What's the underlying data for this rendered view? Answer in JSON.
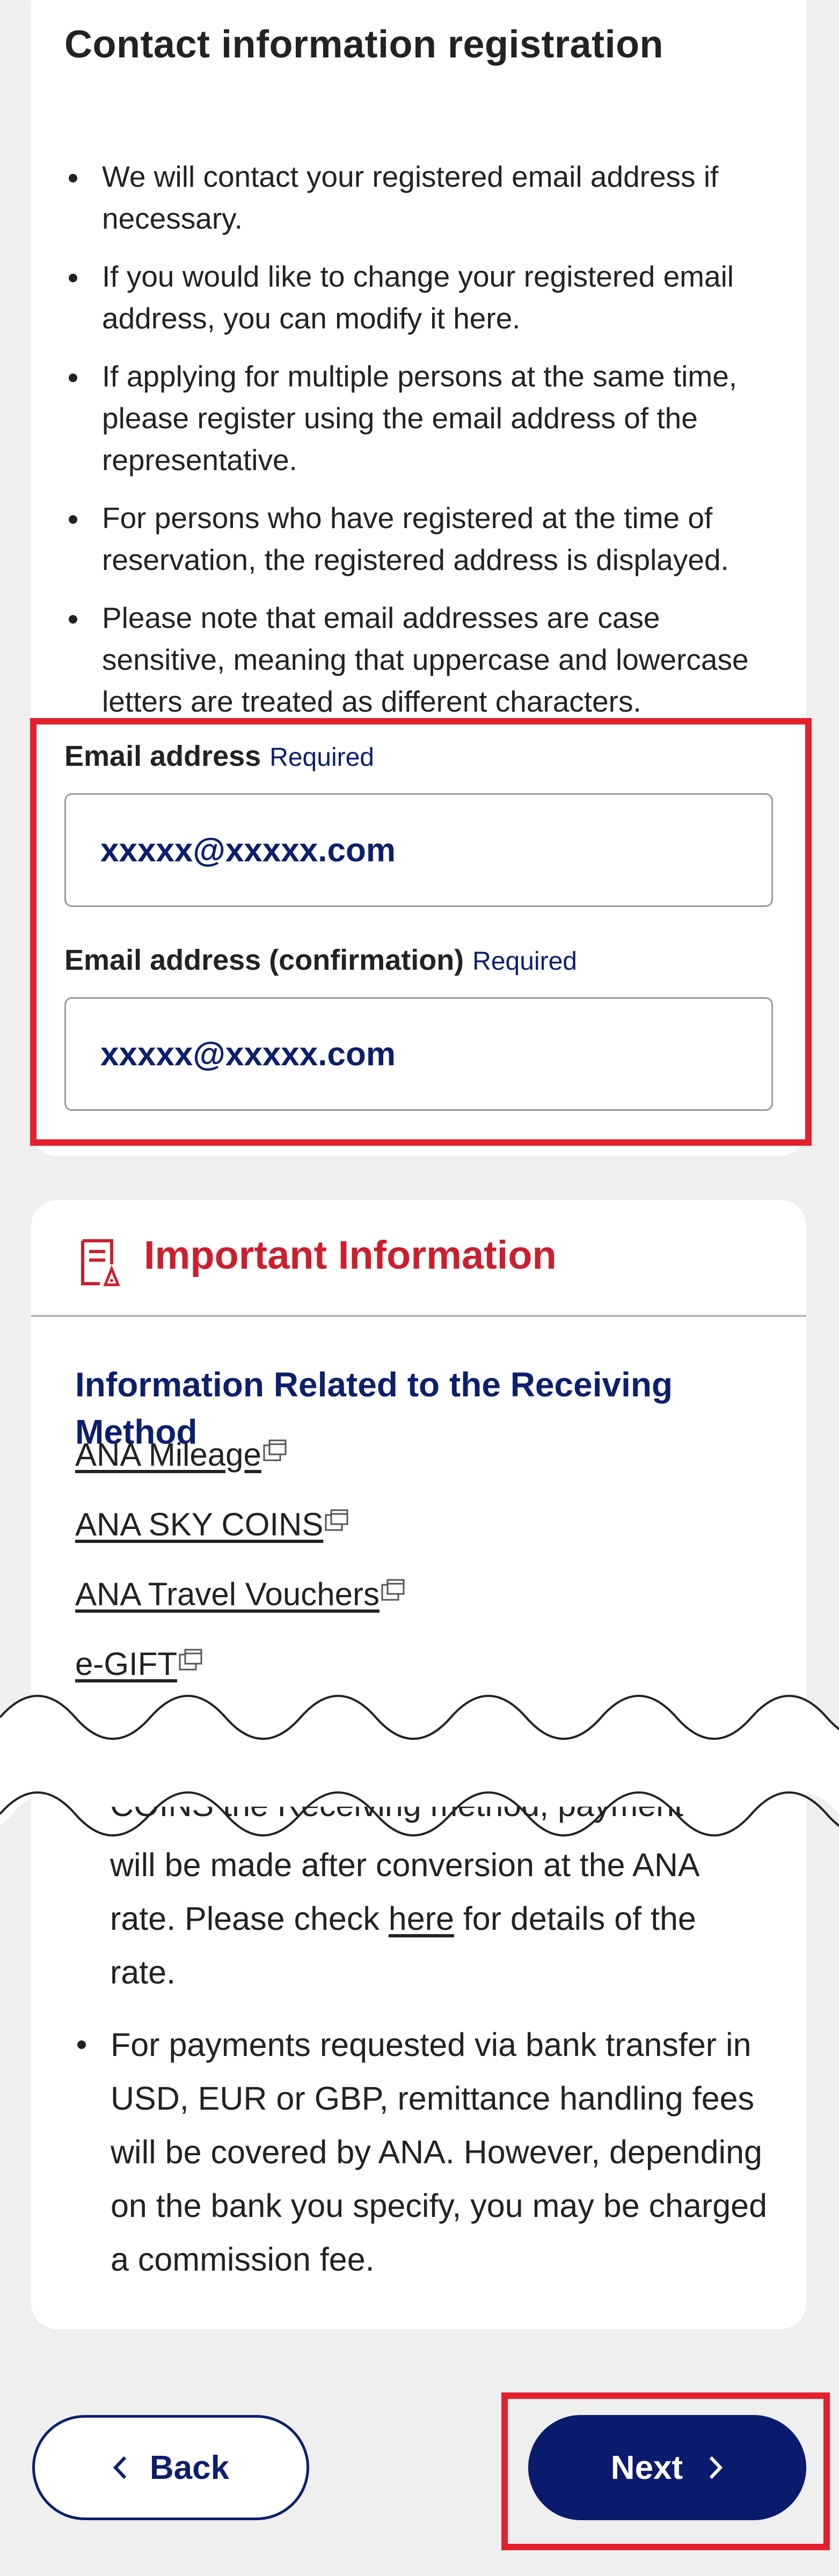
{
  "contact": {
    "title": "Contact information registration",
    "notes": [
      "We will contact your registered email address if necessary.",
      "If you would like to change your registered email address, you can modify it here.",
      "If applying for multiple persons at the same time, please register using the email address of the representative.",
      "For persons who have registered at the time of reservation, the registered address is displayed.",
      "Please note that email addresses are case sensitive, meaning that uppercase and lowercase letters are treated as different characters."
    ],
    "email": {
      "label": "Email address",
      "required": "Required",
      "value": "xxxxx@xxxxx.com"
    },
    "email_confirm": {
      "label": "Email address (confirmation)",
      "required": "Required",
      "value": "xxxxx@xxxxx.com"
    }
  },
  "important": {
    "icon": "document-info-icon",
    "title": "Important Information",
    "section_title": "Information Related to the Receiving Method",
    "links": [
      {
        "label": "ANA Mileage"
      },
      {
        "label": "ANA SKY COINS"
      },
      {
        "label": "ANA Travel Vouchers"
      },
      {
        "label": "e-GIFT"
      }
    ],
    "continued_fragment": "COINS the Receiving method, payment",
    "continued_text_1": "will be made after conversion at the ANA rate. Please check",
    "continued_link": "here",
    "continued_text_2": "for details of the rate.",
    "bank_note": "For payments requested via bank transfer in USD, EUR or GBP, remittance handling fees will be covered by ANA. However, depending on the bank you specify, you may be charged a commission fee."
  },
  "buttons": {
    "back": "Back",
    "next": "Next"
  },
  "colors": {
    "accent_navy": "#0c1f6e",
    "highlight_red": "#e3202c",
    "important_red": "#cc1f2e"
  }
}
